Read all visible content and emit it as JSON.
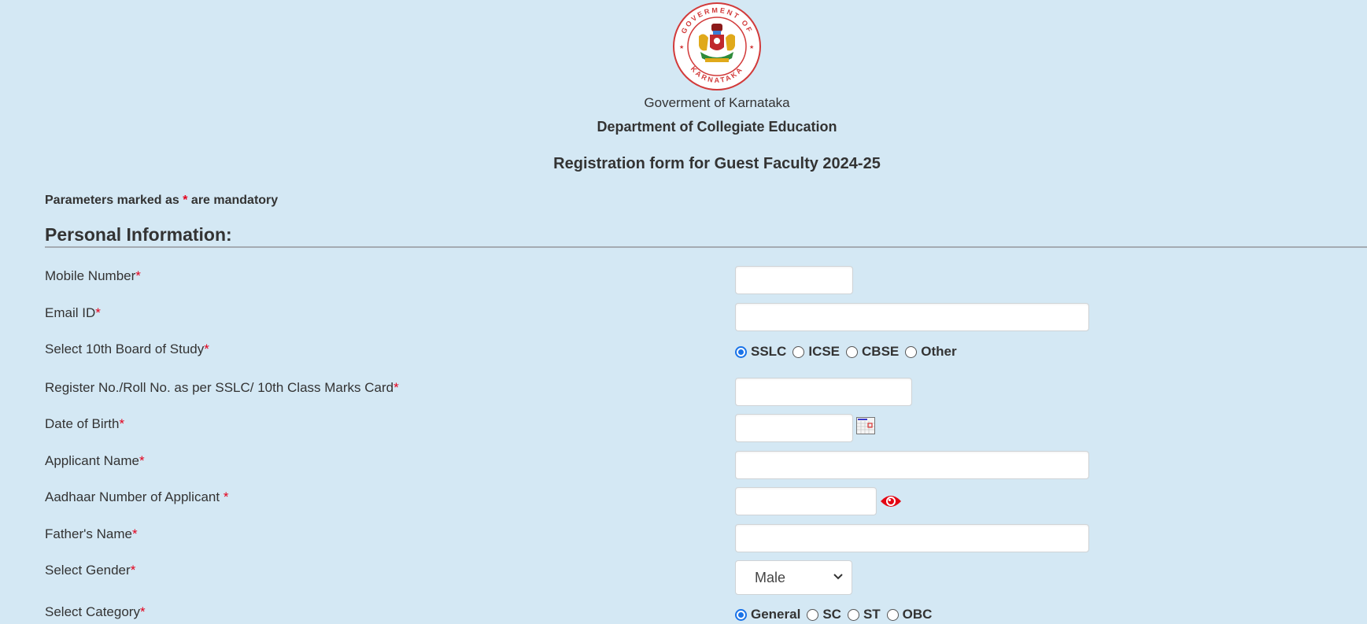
{
  "header": {
    "emblem_alt": "Government of Karnataka emblem",
    "emblem_ring_text_top": "GOVERMENT OF",
    "emblem_ring_text_bottom": "KARNATAKA",
    "government": "Goverment of Karnataka",
    "department": "Department of Collegiate Education",
    "form_title": "Registration form for Guest Faculty 2024-25"
  },
  "notice": {
    "prefix": "Parameters marked as ",
    "star": "*",
    "suffix": " are mandatory"
  },
  "section_title": "Personal Information:",
  "required_mark": "*",
  "fields": {
    "mobile": {
      "label": "Mobile Number",
      "value": ""
    },
    "email": {
      "label": "Email ID",
      "value": ""
    },
    "board": {
      "label": "Select 10th Board of Study",
      "options": [
        "SSLC",
        "ICSE",
        "CBSE",
        "Other"
      ],
      "selected": "SSLC"
    },
    "register_no": {
      "label": "Register No./Roll No. as per SSLC/ 10th Class Marks Card",
      "value": ""
    },
    "dob": {
      "label": "Date of Birth",
      "value": "",
      "icon": "calendar-icon"
    },
    "applicant_name": {
      "label": "Applicant Name",
      "value": ""
    },
    "aadhaar": {
      "label": "Aadhaar Number of Applicant ",
      "value": "",
      "icon": "eye-icon"
    },
    "father_name": {
      "label": "Father's Name",
      "value": ""
    },
    "gender": {
      "label": "Select Gender",
      "selected": "Male"
    },
    "category": {
      "label": "Select Category",
      "options": [
        "General",
        "SC",
        "ST",
        "OBC"
      ],
      "selected": "General"
    }
  },
  "colors": {
    "background": "#d4e8f4",
    "required": "#e4001b",
    "radio_checked": "#1a73e8",
    "eye_icon": "#e30613"
  }
}
